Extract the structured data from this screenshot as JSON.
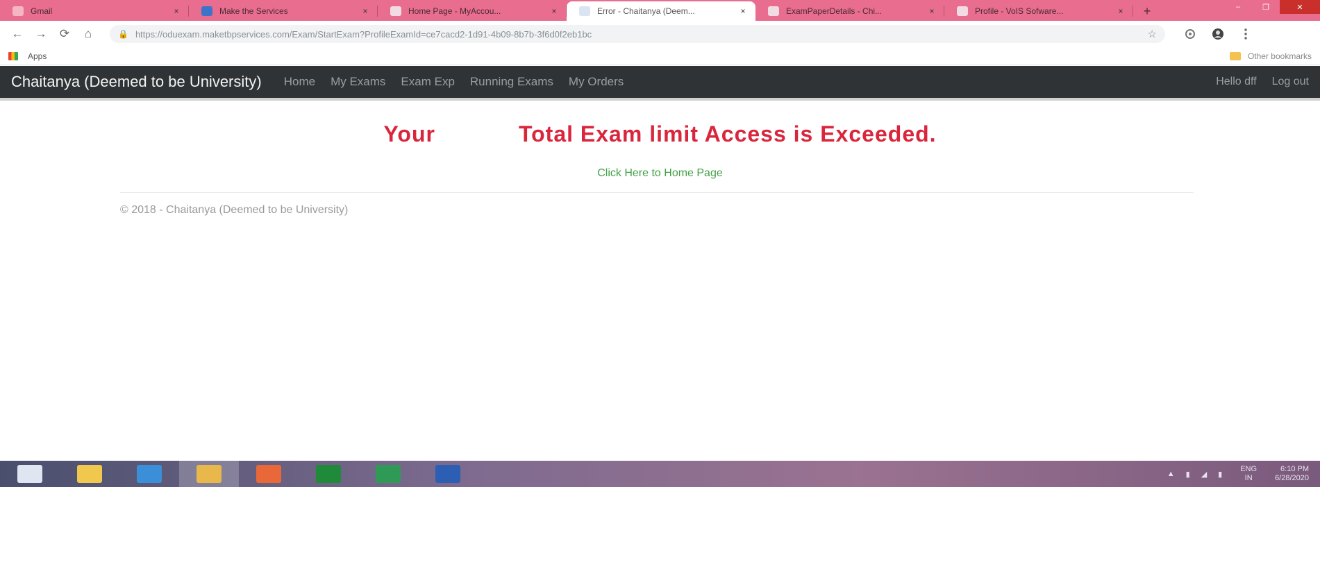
{
  "browser": {
    "tabs": [
      {
        "title": "Gmail",
        "favicon_color": "#f4b6c4",
        "active": false
      },
      {
        "title": "Make the Services",
        "favicon_color": "#3d74c9",
        "active": false
      },
      {
        "title": "Home Page - MyAccou...",
        "favicon_color": "#f2dbe2",
        "active": false
      },
      {
        "title": "Error - Chaitanya (Deem...",
        "favicon_color": "#dbe4f2",
        "active": true
      },
      {
        "title": "ExamPaperDetails - Chi...",
        "favicon_color": "#f2dbe2",
        "active": false
      },
      {
        "title": "Profile - VoIS Sofware...",
        "favicon_color": "#f2dbe2",
        "active": false
      }
    ],
    "new_tab_icon": "+",
    "window_controls": {
      "minimize": "–",
      "maximize": "❐",
      "close": "✕"
    },
    "nav": {
      "back": "←",
      "forward": "→",
      "reload": "⟳",
      "home": "⌂"
    },
    "address": {
      "lock_icon": "🔒",
      "url": "https://oduexam.maketbpservices.com/Exam/StartExam?ProfileExamId=ce7cacd2-1d91-4b09-8b7b-3f6d0f2eb1bc",
      "star_icon": "☆"
    },
    "toolbar_icons": [
      "extension-icon",
      "profile-icon",
      "menu-icon"
    ],
    "bookmarks": {
      "apps_label": "Apps",
      "other_label": "Other bookmarks"
    }
  },
  "site": {
    "brand": "Chaitanya (Deemed to be University)",
    "nav_links": [
      "Home",
      "My Exams",
      "Exam Exp",
      "Running Exams",
      "My Orders"
    ],
    "user_greeting": "Hello dff",
    "logout_label": "Log out",
    "error_part1": "Your",
    "error_part2": "Total Exam limit Access is Exceeded.",
    "home_link": "Click Here to Home Page",
    "footer": "© 2018 - Chaitanya (Deemed to be University)",
    "colors": {
      "error": "#d9263c",
      "link": "#43a047",
      "navbar": "#2f3335"
    }
  },
  "taskbar": {
    "apps": [
      {
        "name": "start",
        "color": "#dfe6f2",
        "active": false
      },
      {
        "name": "file-explorer",
        "color": "#f1c84e",
        "active": false
      },
      {
        "name": "internet-explorer",
        "color": "#3b8fd8",
        "active": false
      },
      {
        "name": "chrome",
        "color": "#e9b84a",
        "active": true
      },
      {
        "name": "firefox",
        "color": "#e8683a",
        "active": false
      },
      {
        "name": "green-app",
        "color": "#1f8a3a",
        "active": false
      },
      {
        "name": "excel",
        "color": "#2f9a55",
        "active": false
      },
      {
        "name": "word",
        "color": "#2c5fb4",
        "active": false
      }
    ],
    "tray_icons": [
      "▲",
      "▮",
      "◢",
      "▮"
    ],
    "language": {
      "top": "ENG",
      "bottom": "IN"
    },
    "clock": {
      "time": "6:10 PM",
      "date": "6/28/2020"
    }
  }
}
